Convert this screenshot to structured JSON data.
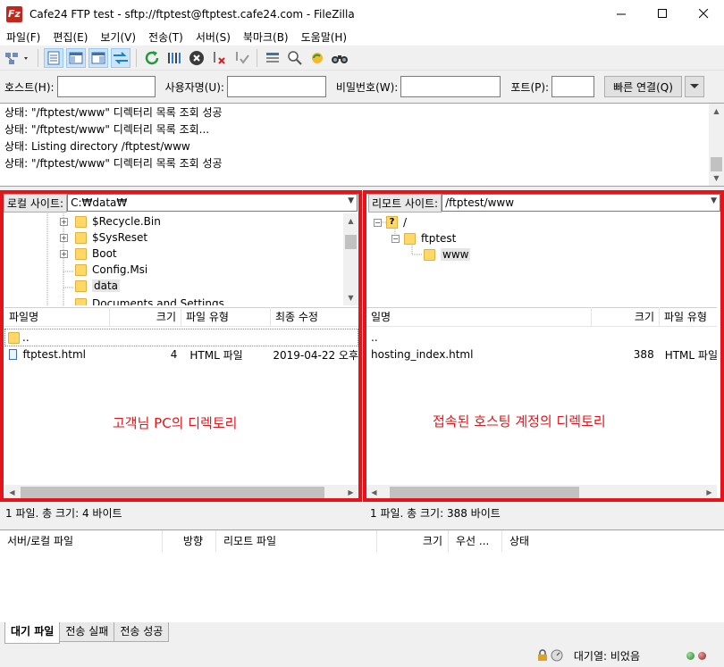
{
  "window": {
    "title": "Cafe24 FTP test - sftp://ftptest@ftptest.cafe24.com - FileZilla",
    "app_icon_letter": "Fz"
  },
  "menu": [
    "파일(F)",
    "편집(E)",
    "보기(V)",
    "전송(T)",
    "서버(S)",
    "북마크(B)",
    "도움말(H)"
  ],
  "quickconnect": {
    "host_label": "호스트(H):",
    "user_label": "사용자명(U):",
    "pass_label": "비밀번호(W):",
    "port_label": "포트(P):",
    "connect_label": "빠른 연결(Q)",
    "host_value": "",
    "user_value": "",
    "pass_value": "",
    "port_value": ""
  },
  "log": [
    "상태:   \"/ftptest/www\" 디렉터리 목록 조회 성공",
    "상태:   \"/ftptest/www\" 디렉터리 목록 조회...",
    "상태:   Listing directory /ftptest/www",
    "상태:   \"/ftptest/www\" 디렉터리 목록 조회 성공"
  ],
  "local": {
    "site_label": "로컬 사이트:",
    "site_path": "C:₩data₩",
    "tree": [
      "$Recycle.Bin",
      "$SysReset",
      "Boot",
      "Config.Msi",
      "data",
      "Documents and Settings"
    ],
    "columns": [
      "파일명",
      "크기",
      "파일 유형",
      "최종 수정"
    ],
    "parent": "..",
    "files": [
      {
        "name": "ftptest.html",
        "size": "4",
        "type": "HTML 파일",
        "modified": "2019-04-22 오후"
      }
    ],
    "note": "고객님 PC의 디렉토리",
    "status": "1 파일. 총 크기: 4 바이트"
  },
  "remote": {
    "site_label": "리모트 사이트:",
    "site_path": "/ftptest/www",
    "tree": [
      "/",
      "ftptest",
      "www"
    ],
    "columns": [
      "일명",
      "크기",
      "파일 유형"
    ],
    "parent": "..",
    "files": [
      {
        "name": "hosting_index.html",
        "size": "388",
        "type": "HTML 파일"
      }
    ],
    "note": "접속된 호스팅 계정의 디렉토리",
    "status": "1 파일. 총 크기: 388 바이트"
  },
  "queue": {
    "columns": [
      "서버/로컬 파일",
      "방향",
      "리모트 파일",
      "크기",
      "우선 ...",
      "상태"
    ],
    "tabs": [
      "대기 파일",
      "전송 실패",
      "전송 성공"
    ]
  },
  "footer": {
    "queue_status": "대기열: 비었음"
  },
  "colors": {
    "highlight": "#e3151b",
    "folder": "#ffd866"
  }
}
